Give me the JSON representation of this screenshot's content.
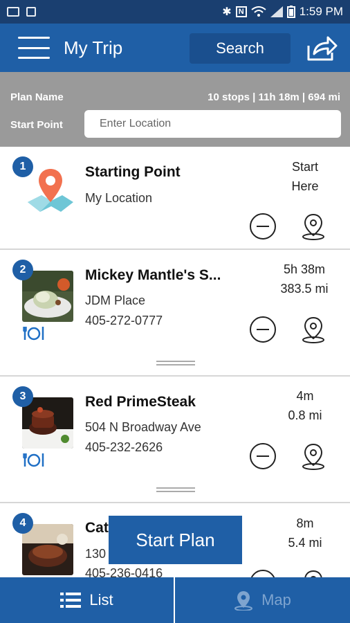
{
  "status_bar": {
    "time": "1:59 PM"
  },
  "app_bar": {
    "title": "My Trip",
    "search_label": "Search"
  },
  "plan": {
    "name_label": "Plan Name",
    "summary": "10 stops | 11h 18m | 694 mi",
    "start_label": "Start Point",
    "start_placeholder": "Enter Location"
  },
  "stops": [
    {
      "number": "1",
      "name": "Starting Point",
      "line1": "My Location",
      "line2": "",
      "metric_top": "Start",
      "metric_bottom": "Here",
      "icon": "map-pin-icon"
    },
    {
      "number": "2",
      "name": "Mickey Mantle's S...",
      "line1": "JDM Place",
      "line2": "405-272-0777",
      "metric_top": "5h 38m",
      "metric_bottom": "383.5 mi",
      "icon": "food-photo"
    },
    {
      "number": "3",
      "name": "Red PrimeSteak",
      "line1": "504 N Broadway Ave",
      "line2": "405-232-2626",
      "metric_top": "4m",
      "metric_bottom": "0.8 mi",
      "icon": "food-photo"
    },
    {
      "number": "4",
      "name": "Cat",
      "line1": "130",
      "line2": "405-236-0416",
      "metric_top": "8m",
      "metric_bottom": "5.4 mi",
      "icon": "food-photo"
    }
  ],
  "start_plan_label": "Start Plan",
  "bottom_nav": {
    "list_label": "List",
    "map_label": "Map"
  },
  "colors": {
    "primary": "#1f5fa6",
    "status_bar": "#1a3f70",
    "plan_bar": "#9a9a9a",
    "map_inactive": "#7ea4cf"
  }
}
